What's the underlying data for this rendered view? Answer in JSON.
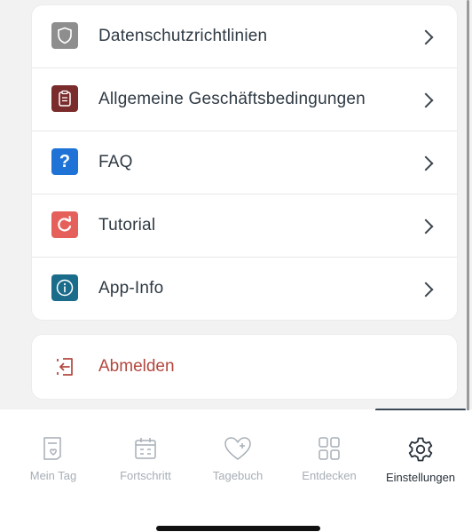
{
  "settings_menu": {
    "items": [
      {
        "label": "Datenschutzrichtlinien",
        "icon": "shield-icon",
        "icon_bg": "#8e8e8e"
      },
      {
        "label": "Allgemeine Geschäftsbedingungen",
        "icon": "clipboard-icon",
        "icon_bg": "#7a2b2b"
      },
      {
        "label": "FAQ",
        "icon": "question-icon",
        "icon_bg": "#1f73d6",
        "glyph": "?"
      },
      {
        "label": "Tutorial",
        "icon": "replay-icon",
        "icon_bg": "#e5605a"
      },
      {
        "label": "App-Info",
        "icon": "info-icon",
        "icon_bg": "#1a6c8a"
      }
    ]
  },
  "logout": {
    "label": "Abmelden",
    "icon": "logout-icon",
    "color": "#b3473f"
  },
  "tabbar": {
    "tabs": [
      {
        "label": "Mein Tag",
        "icon": "day-card-heart-icon",
        "active": false
      },
      {
        "label": "Fortschritt",
        "icon": "calendar-icon",
        "active": false
      },
      {
        "label": "Tagebuch",
        "icon": "heart-plus-icon",
        "active": false
      },
      {
        "label": "Entdecken",
        "icon": "grid-icon",
        "active": false
      },
      {
        "label": "Einstellungen",
        "icon": "gear-icon",
        "active": true
      }
    ],
    "inactive_color": "#a6aeb5",
    "active_color": "#28323b"
  }
}
